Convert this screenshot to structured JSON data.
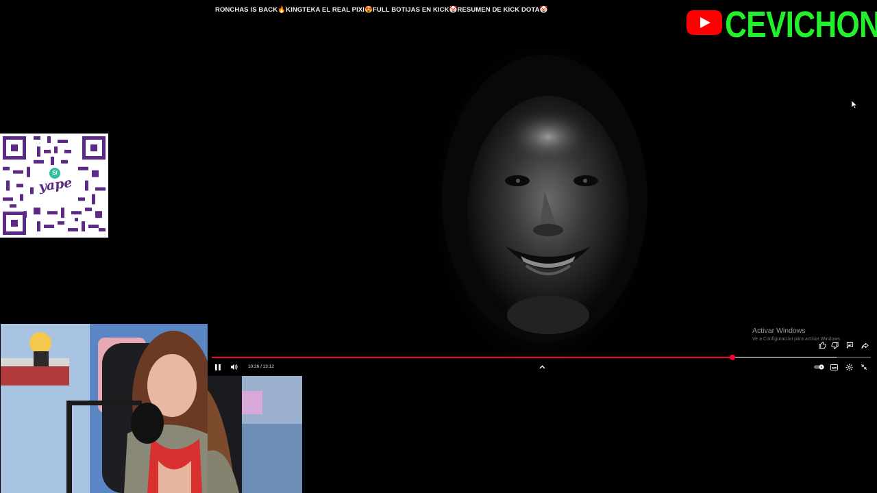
{
  "video": {
    "title": "RONCHAS IS BACK🔥KINGTEKA EL REAL PIXI😍FULL BOTIJAS EN KICK🤡RESUMEN DE KICK DOTA🤡",
    "current_time": "10:26",
    "duration": "13:12",
    "time_display": "10:26 / 13:12",
    "progress": 0.79,
    "buffered": 0.948
  },
  "overlay": {
    "channel_name": "CEVICHON",
    "qr_brand": "yape",
    "qr_badge": "S/"
  },
  "windows_watermark": {
    "line1": "Activar Windows",
    "line2": "Ve a Configuración para activar Windows."
  },
  "colors": {
    "accent": "#ff0033",
    "channel_green": "#22f02a",
    "youtube_red": "#ff0000",
    "yape_purple": "#5b2a86",
    "yape_teal": "#2fbf9b"
  },
  "icons": {
    "play_pause": "pause-icon",
    "volume": "volume-icon",
    "chapters": "chevron-up-icon",
    "autoplay": "autoplay-toggle-icon",
    "subtitles": "subtitles-icon",
    "settings": "gear-icon",
    "fullscreen_exit": "exit-fullscreen-icon",
    "like": "thumbs-up-icon",
    "dislike": "thumbs-down-icon",
    "comment": "comment-icon",
    "share": "share-icon"
  }
}
